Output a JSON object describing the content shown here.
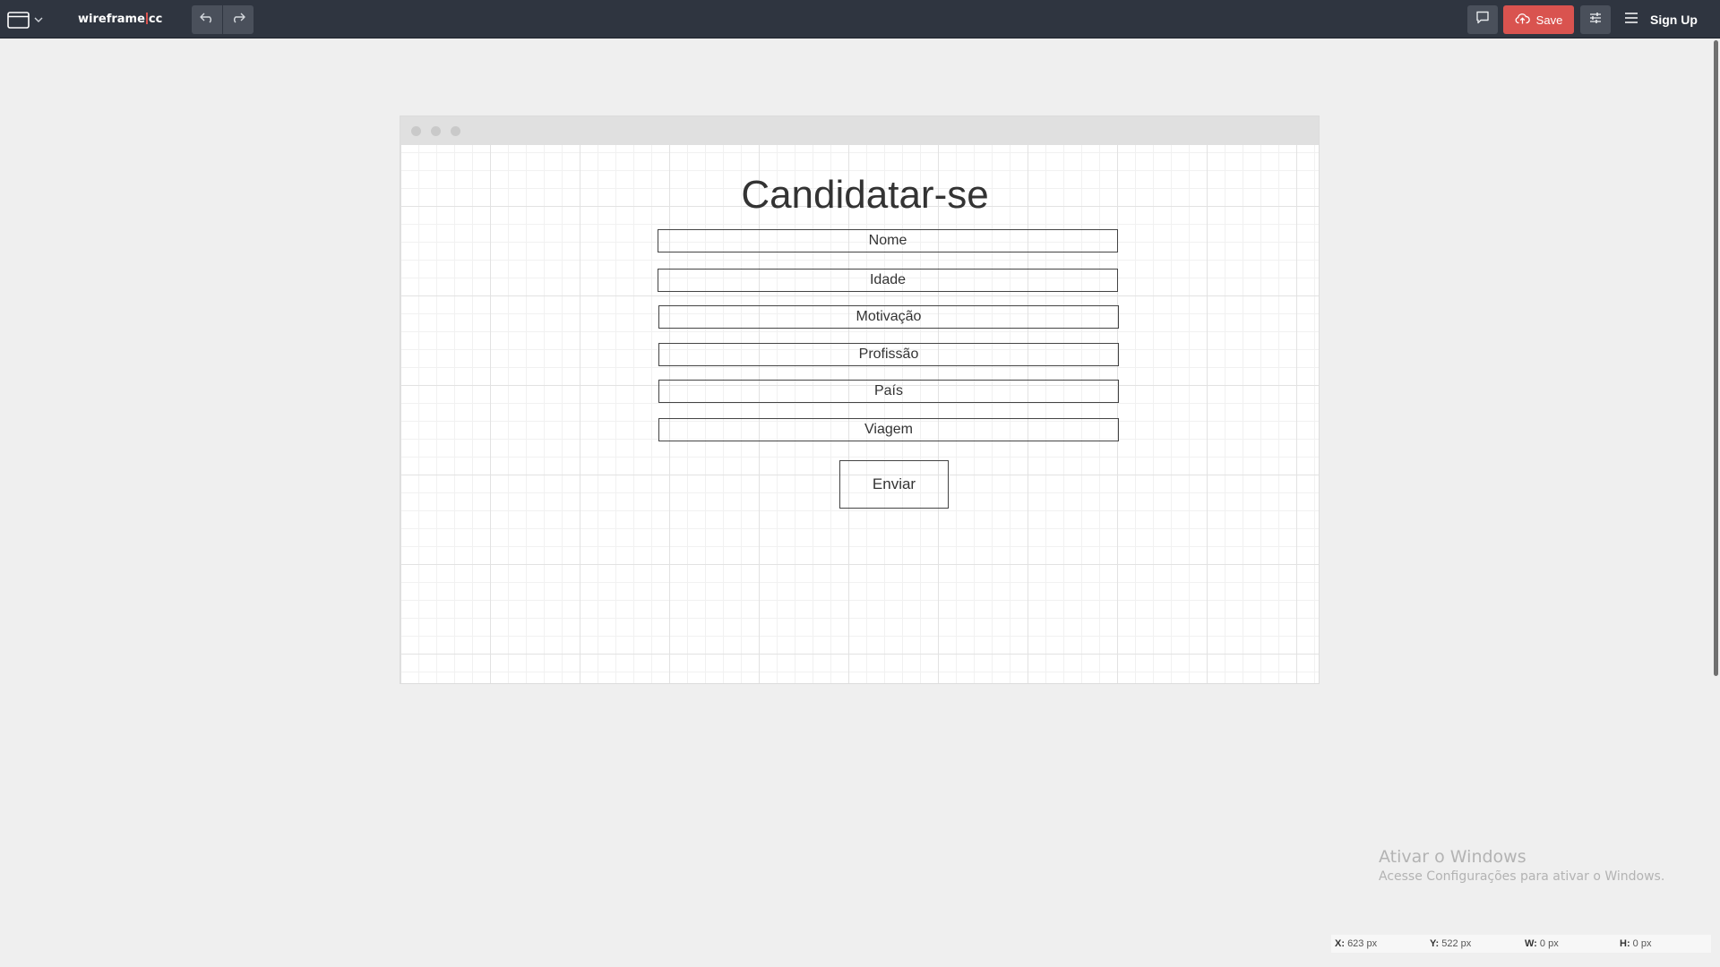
{
  "app": {
    "logo_left": "wireframe",
    "logo_right": "cc",
    "window_menu_icon": "browser-window-icon",
    "undo_icon": "undo-icon",
    "redo_icon": "redo-icon",
    "comment_icon": "comment-icon",
    "save_label": "Save",
    "save_icon": "cloud-upload-icon",
    "settings_icon": "sliders-icon",
    "menu_icon": "hamburger-menu-icon",
    "signup_label": "Sign Up"
  },
  "canvas": {
    "title": "Candidatar-se",
    "fields": [
      "Nome",
      "Idade",
      "Motivação",
      "Profissão",
      "País",
      "Viagem"
    ],
    "submit_label": "Enviar"
  },
  "watermark": {
    "title": "Ativar o Windows",
    "subtitle": "Acesse Configurações para ativar o Windows."
  },
  "status": {
    "x_label": "X:",
    "x_value": "623 px",
    "y_label": "Y:",
    "y_value": "522 px",
    "w_label": "W:",
    "w_value": "0 px",
    "h_label": "H:",
    "h_value": "0 px"
  },
  "colors": {
    "toolbar_bg": "#2f3540",
    "toolbar_button": "#4a505b",
    "save_accent": "#d9534f",
    "workspace_bg": "#efefef"
  }
}
